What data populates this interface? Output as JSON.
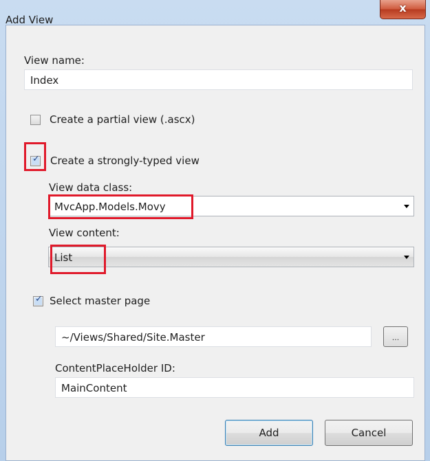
{
  "window": {
    "title": "Add View",
    "close_label": "x"
  },
  "view_name": {
    "label": "View name:",
    "value": "Index"
  },
  "partial_view": {
    "label": "Create a partial view (.ascx)",
    "checked": false
  },
  "strongly_typed": {
    "label": "Create a strongly-typed view",
    "checked": true
  },
  "data_class": {
    "label": "View data class:",
    "value": "MvcApp.Models.Movy"
  },
  "view_content": {
    "label": "View content:",
    "value": "List"
  },
  "master_page": {
    "label": "Select master page",
    "checked": true,
    "path": "~/Views/Shared/Site.Master",
    "browse_label": "..."
  },
  "placeholder": {
    "label": "ContentPlaceHolder ID:",
    "value": "MainContent"
  },
  "buttons": {
    "add": "Add",
    "cancel": "Cancel"
  },
  "colors": {
    "highlight": "#e0192a",
    "titlebar": "#c9dcf1",
    "close": "#cf5a3d"
  }
}
